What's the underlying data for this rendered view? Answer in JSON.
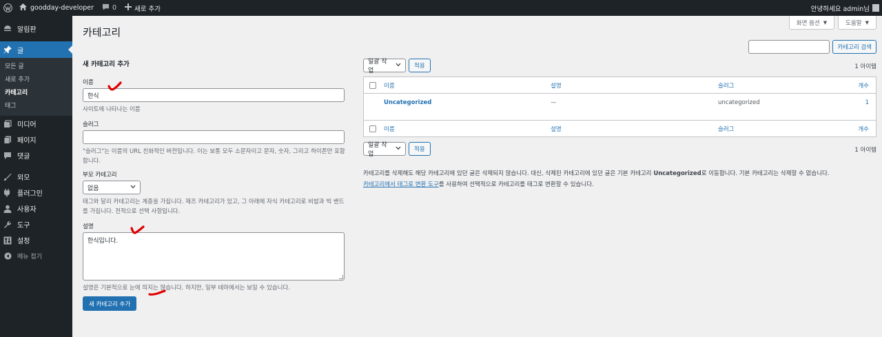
{
  "adminbar": {
    "site_name": "goodday-developer",
    "comments_count": "0",
    "new_label": "새로 추가",
    "greeting": "안녕하세요 admin님"
  },
  "sidebar": {
    "items": [
      {
        "label": "알림판",
        "icon": "dashboard-icon"
      },
      {
        "label": "글",
        "icon": "pin-icon"
      },
      {
        "label": "미디어",
        "icon": "media-icon"
      },
      {
        "label": "페이지",
        "icon": "page-icon"
      },
      {
        "label": "댓글",
        "icon": "comment-icon"
      },
      {
        "label": "외모",
        "icon": "brush-icon"
      },
      {
        "label": "플러그인",
        "icon": "plugin-icon"
      },
      {
        "label": "사용자",
        "icon": "user-icon"
      },
      {
        "label": "도구",
        "icon": "wrench-icon"
      },
      {
        "label": "설정",
        "icon": "settings-icon"
      },
      {
        "label": "메뉴 접기",
        "icon": "collapse-icon"
      }
    ],
    "submenu": [
      "모든 글",
      "새로 추가",
      "카테고리",
      "태그"
    ]
  },
  "screen_options": "화면 옵션",
  "help": "도움말",
  "page_title": "카테고리",
  "search": {
    "button": "카테고리 검색",
    "value": ""
  },
  "form": {
    "heading": "새 카테고리 추가",
    "name_label": "이름",
    "name_value": "한식",
    "name_help": "사이트에 나타나는 이름",
    "slug_label": "슬러그",
    "slug_value": "",
    "slug_help": "\"슬러그\"는 이름의 URL 친화적인 버전입니다. 이는 보통 모두 소문자이고 문자, 숫자, 그리고 하이픈만 포함합니다.",
    "parent_label": "부모 카테고리",
    "parent_value": "없음",
    "parent_help": "태그와 달리 카테고리는 계층을 가집니다. 재즈 카테고리가 있고, 그 아래에 자식 카테고리로 비밥과 빅 밴드를 가집니다. 전적으로 선택 사항입니다.",
    "desc_label": "설명",
    "desc_value": "한식입니다.",
    "desc_help": "설명은 기본적으로 눈에 띄지는 않습니다. 하지만, 일부 테마에서는 보일 수 있습니다.",
    "submit": "새 카테고리 추가"
  },
  "table": {
    "bulk_label": "일괄 작업",
    "apply": "적용",
    "count": "1 아이템",
    "columns": {
      "name": "이름",
      "description": "설명",
      "slug": "슬러그",
      "count": "개수"
    },
    "rows": [
      {
        "name": "Uncategorized",
        "description": "—",
        "slug": "uncategorized",
        "count": "1"
      }
    ]
  },
  "note": {
    "line1_prefix": "카테고리를 삭제해도 해당 카테고리에 있던 글은 삭제되지 않습니다. 대신, 삭제된 카테고리에 있던 글은 기본 카테고리 ",
    "line1_bold": "Uncategorized",
    "line1_suffix": "로 이동합니다. 기본 카테고리는 삭제할 수 없습니다.",
    "link": "카테고리에서 태그로 변환 도구",
    "line2_suffix": "를 사용하여 선택적으로 카테고리를 태그로 변환할 수 있습니다."
  },
  "colors": {
    "accent": "#2271b1",
    "adminbar": "#1d2327",
    "annotation": "#e00000"
  }
}
